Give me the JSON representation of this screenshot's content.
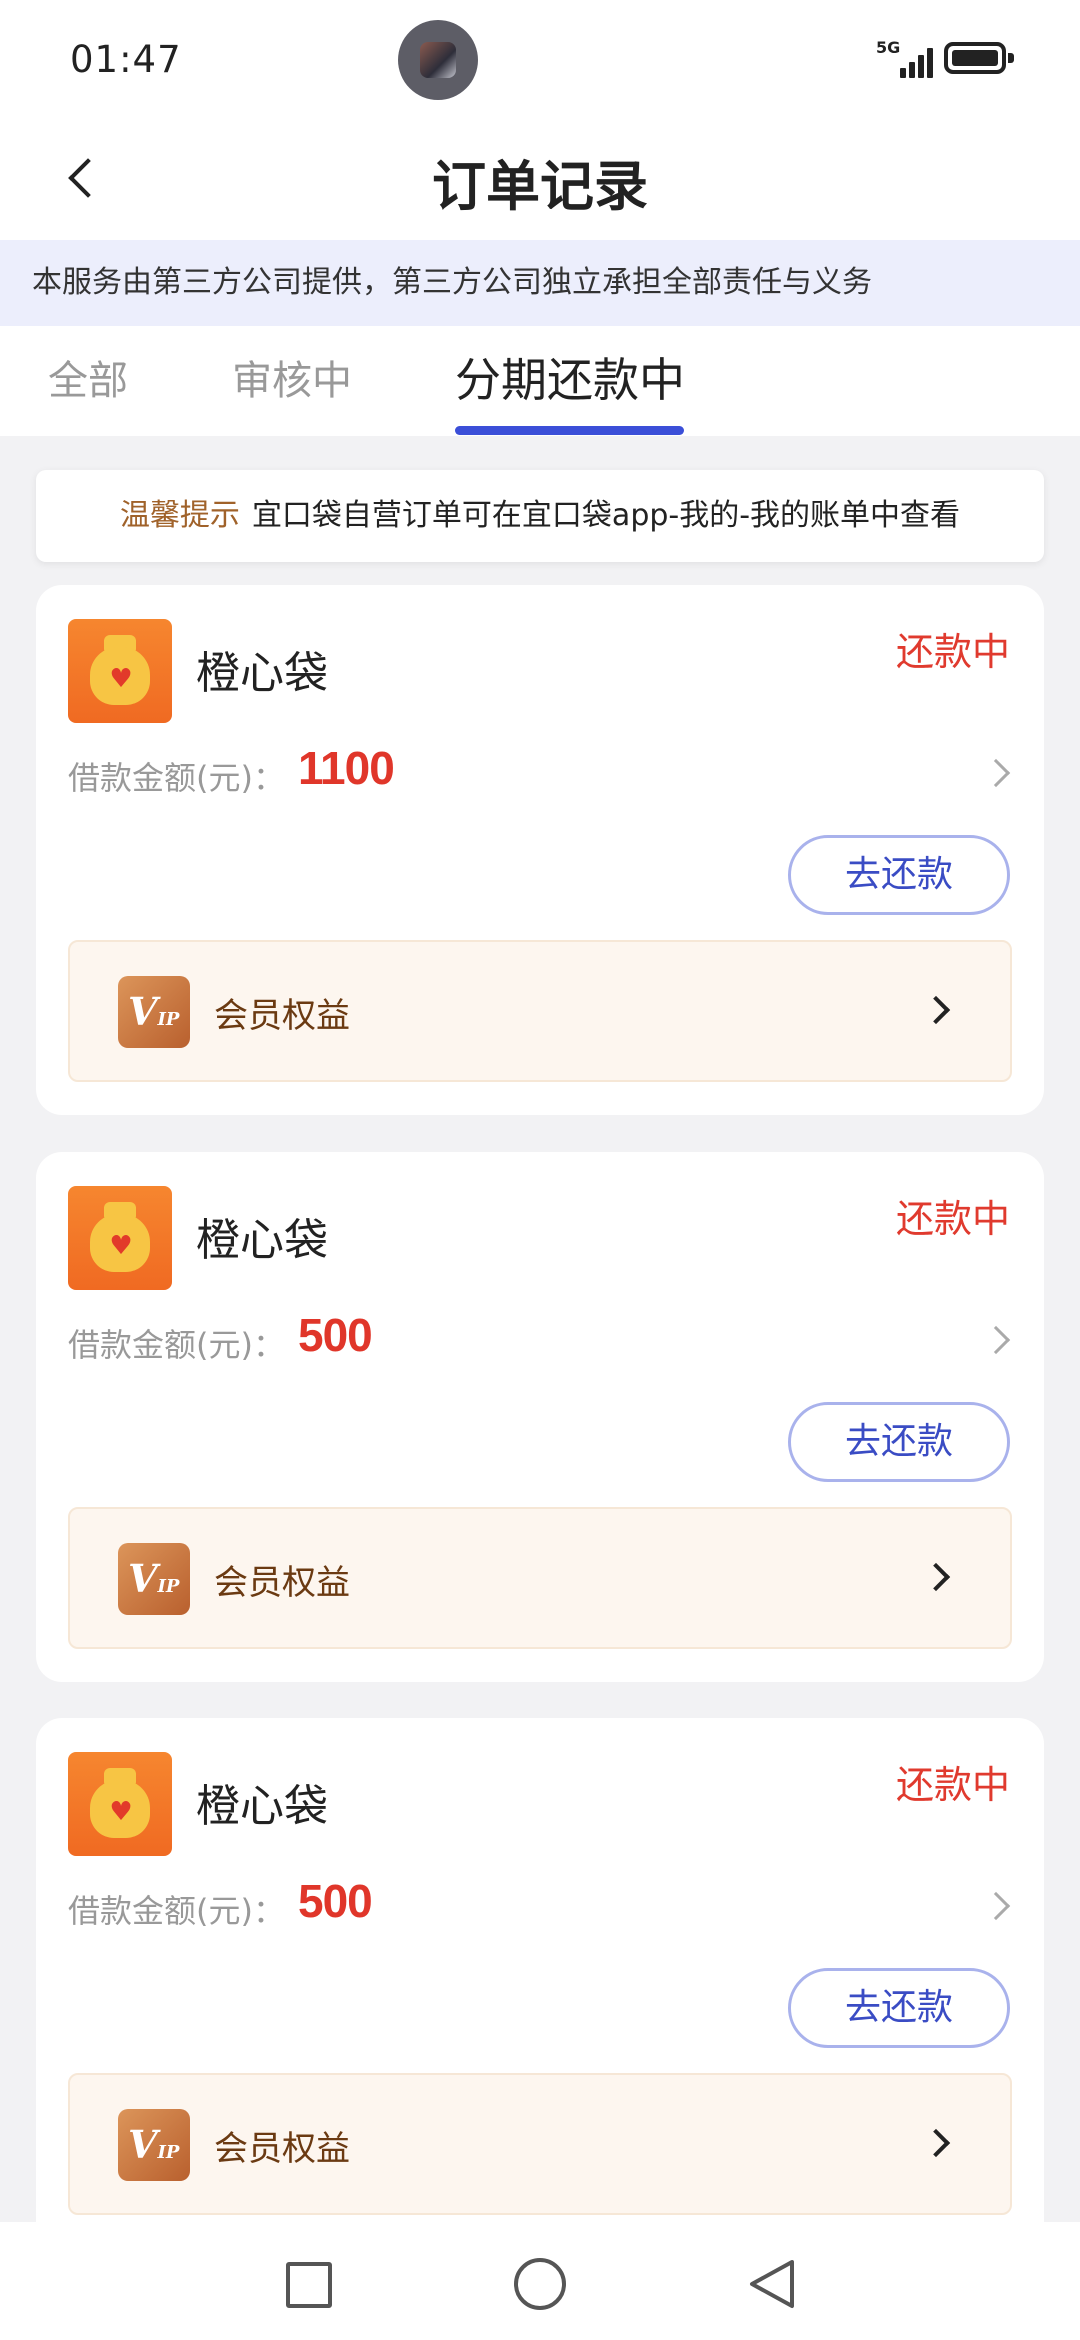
{
  "status_bar": {
    "time": "01:47",
    "network": "5G"
  },
  "nav": {
    "title": "订单记录"
  },
  "notice": "本服务由第三方公司提供，第三方公司独立承担全部责任与义务",
  "tabs": [
    {
      "label": "全部",
      "active": false
    },
    {
      "label": "审核中",
      "active": false
    },
    {
      "label": "分期还款中",
      "active": true
    }
  ],
  "tip": {
    "label": "温馨提示",
    "text": "宜口袋自营订单可在宜口袋app-我的-我的账单中查看"
  },
  "orders": [
    {
      "brand": "橙心袋",
      "status": "还款中",
      "amount_label": "借款金额(元)：",
      "amount": "1100",
      "repay_label": "去还款",
      "vip_label": "会员权益"
    },
    {
      "brand": "橙心袋",
      "status": "还款中",
      "amount_label": "借款金额(元)：",
      "amount": "500",
      "repay_label": "去还款",
      "vip_label": "会员权益"
    },
    {
      "brand": "橙心袋",
      "status": "还款中",
      "amount_label": "借款金额(元)：",
      "amount": "500",
      "repay_label": "去还款",
      "vip_label": "会员权益"
    }
  ],
  "vip_badge": {
    "main": "V",
    "sub": "IP"
  },
  "colors": {
    "accent": "#3b4fd8",
    "status_red": "#e03a2e",
    "brand_orange": "#f06a22"
  }
}
